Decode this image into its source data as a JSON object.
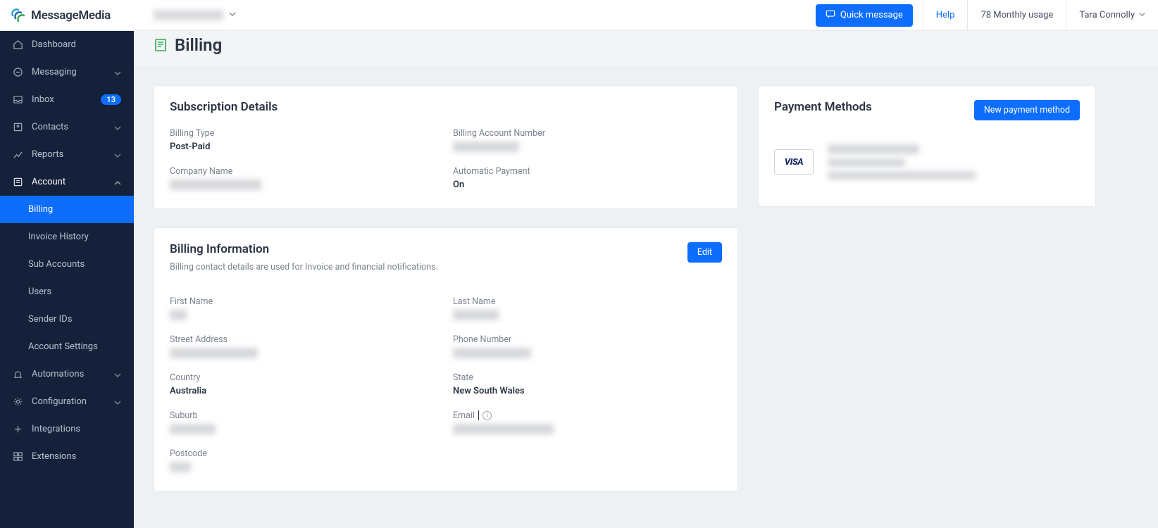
{
  "brand": {
    "name": "MessageMedia"
  },
  "topbar": {
    "workspace_redacted": "workspace name",
    "quick_message": "Quick message",
    "help": "Help",
    "usage": "78 Monthly usage",
    "user": "Tara Connolly"
  },
  "sidebar": {
    "items": [
      {
        "label": "Dashboard",
        "icon": "home"
      },
      {
        "label": "Messaging",
        "icon": "message",
        "chevron": true
      },
      {
        "label": "Inbox",
        "icon": "inbox",
        "badge": "13"
      },
      {
        "label": "Contacts",
        "icon": "contacts",
        "chevron": true
      },
      {
        "label": "Reports",
        "icon": "chart",
        "chevron": true
      },
      {
        "label": "Account",
        "icon": "account",
        "chevron": "up",
        "active": true
      },
      {
        "label": "Automations",
        "icon": "bell",
        "chevron": true
      },
      {
        "label": "Configuration",
        "icon": "gear",
        "chevron": true
      },
      {
        "label": "Integrations",
        "icon": "integration"
      },
      {
        "label": "Extensions",
        "icon": "grid"
      }
    ],
    "account_sub": [
      {
        "label": "Billing",
        "active": true
      },
      {
        "label": "Invoice History"
      },
      {
        "label": "Sub Accounts"
      },
      {
        "label": "Users"
      },
      {
        "label": "Sender IDs"
      },
      {
        "label": "Account Settings"
      }
    ]
  },
  "page": {
    "title": "Billing"
  },
  "subscription": {
    "title": "Subscription Details",
    "billing_type_label": "Billing Type",
    "billing_type_value": "Post-Paid",
    "account_number_label": "Billing Account Number",
    "account_number_value": "REDACTED0000",
    "company_label": "Company Name",
    "company_value": "REDACTED COMPANY",
    "auto_payment_label": "Automatic Payment",
    "auto_payment_value": "On"
  },
  "billing_info": {
    "title": "Billing Information",
    "subtitle": "Billing contact details are used for Invoice and financial notifications.",
    "edit": "Edit",
    "first_name_label": "First Name",
    "first_name_value": "RED",
    "last_name_label": "Last Name",
    "last_name_value": "REDACTED",
    "street_label": "Street Address",
    "street_value": "REDACTED ADDRESS",
    "phone_label": "Phone Number",
    "phone_value": "REDACTED PHONE",
    "country_label": "Country",
    "country_value": "Australia",
    "state_label": "State",
    "state_value": "New South Wales",
    "suburb_label": "Suburb",
    "suburb_value": "REDACTED",
    "email_label": "Email",
    "email_value": "REDACTED EMAIL ADDR",
    "postcode_label": "Postcode",
    "postcode_value": "0000"
  },
  "payment": {
    "title": "Payment Methods",
    "new_button": "New payment method",
    "card_brand": "VISA",
    "line1": "REDACTED CARD NUM **",
    "line2": "REDACTED NAME",
    "line3": "REDACTED EXPIRY / DETAILS LONGER LINE"
  }
}
